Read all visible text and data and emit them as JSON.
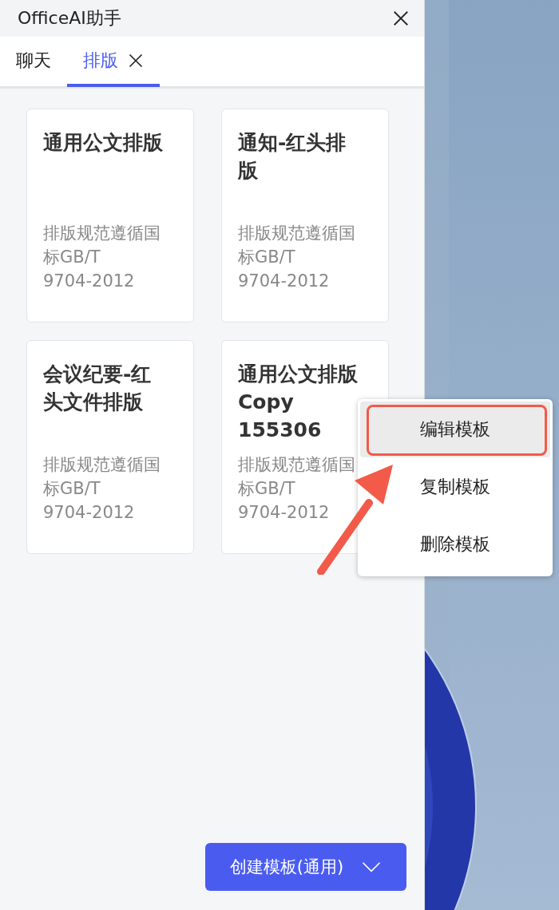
{
  "window": {
    "title": "OfficeAI助手"
  },
  "tabs": [
    {
      "label": "聊天",
      "selected": false,
      "closable": false
    },
    {
      "label": "排版",
      "selected": true,
      "closable": true
    }
  ],
  "templates": [
    {
      "title": "通用公文排版",
      "description": "排版规范遵循国标GB/T 9704-2012"
    },
    {
      "title": "通知-红头排版",
      "description": "排版规范遵循国标GB/T 9704-2012"
    },
    {
      "title": "会议纪要-红头文件排版",
      "description": "排版规范遵循国标GB/T 9704-2012"
    },
    {
      "title": "通用公文排版Copy 155306",
      "description": "排版规范遵循国标GB/T 9704-2012"
    }
  ],
  "context_menu": {
    "items": [
      {
        "label": "编辑模板",
        "selected": true
      },
      {
        "label": "复制模板",
        "selected": false
      },
      {
        "label": "删除模板",
        "selected": false
      }
    ]
  },
  "create_button": {
    "label": "创建模板(通用)"
  }
}
